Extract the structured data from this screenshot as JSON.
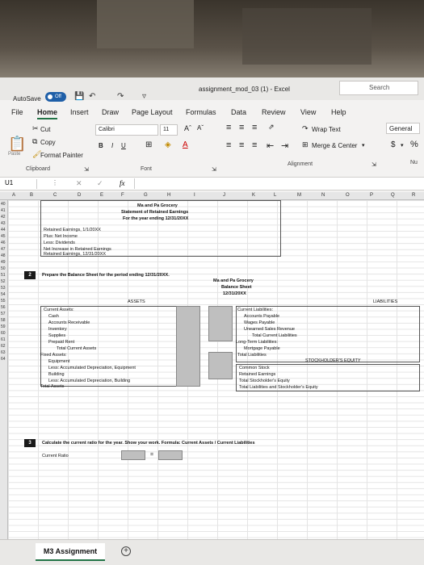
{
  "titlebar": {
    "autosave_label": "AutoSave",
    "autosave_state": "Off",
    "doc_title": "assignment_mod_03 (1)  -  Excel",
    "search_placeholder": "Search"
  },
  "menu": [
    "File",
    "Home",
    "Insert",
    "Draw",
    "Page Layout",
    "Formulas",
    "Data",
    "Review",
    "View",
    "Help"
  ],
  "ribbon": {
    "cut": "Cut",
    "copy": "Copy",
    "format_painter": "Format Painter",
    "paste": "Paste",
    "clipboard": "Clipboard",
    "font_name": "Calibri",
    "font_size": "11",
    "font_group": "Font",
    "bold": "B",
    "italic": "I",
    "underline": "U",
    "wrap_text": "Wrap Text",
    "merge_center": "Merge & Center",
    "alignment": "Alignment",
    "number_format": "General",
    "currency": "$",
    "percent": "%",
    "number_group": "Nu"
  },
  "formula_bar": {
    "name_box": "U1",
    "fx": "fx"
  },
  "columns": [
    "A",
    "B",
    "C",
    "D",
    "E",
    "F",
    "G",
    "H",
    "I",
    "J",
    "K",
    "L",
    "M",
    "N",
    "O",
    "P",
    "Q",
    "R"
  ],
  "rows": [
    "40",
    "41",
    "42",
    "43",
    "44",
    "45",
    "46",
    "47",
    "48",
    "49",
    "50",
    "51",
    "52",
    "53",
    "54",
    "55",
    "56",
    "57",
    "58",
    "59",
    "60",
    "61",
    "62",
    "63",
    "64"
  ],
  "retained": {
    "company": "Ma and Pa Grocery",
    "title": "Statement of Retained Earnings",
    "period": "For the year ending 12/31/20XX",
    "lines": [
      "Retained Earnings, 1/1/20XX",
      "Plus: Net Income",
      "Less: Dividends",
      "Net Increase in Retained Earnings",
      "Retained Earnings, 12/31/20XX"
    ]
  },
  "task2": {
    "number": "2",
    "instruction": "Prepare the Balance Sheet for the period ending 12/31/20XX.",
    "company": "Ma and Pa Grocery",
    "title": "Balance Sheet",
    "date": "12/31/20XX",
    "assets_header": "ASSETS",
    "liabilities_header": "LIABILITIES",
    "equity_header": "STOCKHOLDER'S EQUITY",
    "assets": [
      "Current Assets:",
      "Cash",
      "Accounts Receivable",
      "Inventory",
      "Supplies",
      "Prepaid Rent",
      "Total Current Assets",
      "Fixed Assets:",
      "Equipment",
      "Less: Accumulated Depreciation, Equipment",
      "Building",
      "Less: Accumulated Depreciation, Building",
      "Total Assets"
    ],
    "liabilities": [
      "Current Liabilities:",
      "Accounts Payable",
      "Wages Payable",
      "Unearned Sales Revenue",
      "Total Current Liabilities",
      "Long-Term Liabilities:",
      "Mortgage Payable",
      "Total Liabilities"
    ],
    "equity": [
      "Common Stock",
      "Retained Earnings",
      "Total Stockholder's Equity",
      "Total Liabilities and Stockholder's Equity"
    ]
  },
  "task3": {
    "number": "3",
    "instruction": "Calculate the current ratio for the year. Show your work. Formula: Current Assets / Current Liabilities",
    "label": "Current Ratio",
    "operator": "="
  },
  "sheet_tab": "M3 Assignment",
  "add_sheet": "+"
}
